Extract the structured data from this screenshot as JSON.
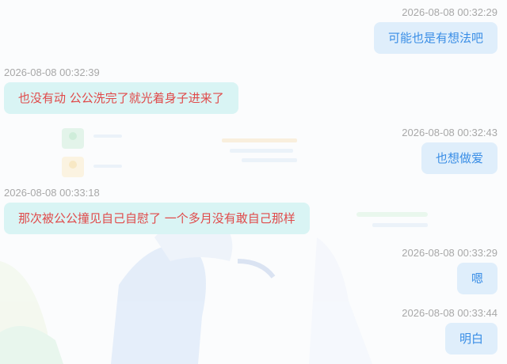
{
  "messages": [
    {
      "side": "out",
      "time": "2026-08-08 00:32:29",
      "text": "可能也是有想法吧"
    },
    {
      "side": "in",
      "time": "2026-08-08 00:32:39",
      "text": "也没有动 公公洗完了就光着身子进来了"
    },
    {
      "side": "out",
      "time": "2026-08-08 00:32:43",
      "text": "也想做爱"
    },
    {
      "side": "in",
      "time": "2026-08-08 00:33:18",
      "text": "那次被公公撞见自己自慰了 一个多月没有敢自己那样"
    },
    {
      "side": "out",
      "time": "2026-08-08 00:33:29",
      "text": "嗯"
    },
    {
      "side": "out",
      "time": "2026-08-08 00:33:44",
      "text": "明白"
    }
  ],
  "colors": {
    "outgoing_bubble": "#dfeefb",
    "outgoing_text": "#3a8ee6",
    "incoming_bubble": "#d9f4f4",
    "incoming_text": "#e04a4a",
    "timestamp": "#a8a8a8"
  }
}
